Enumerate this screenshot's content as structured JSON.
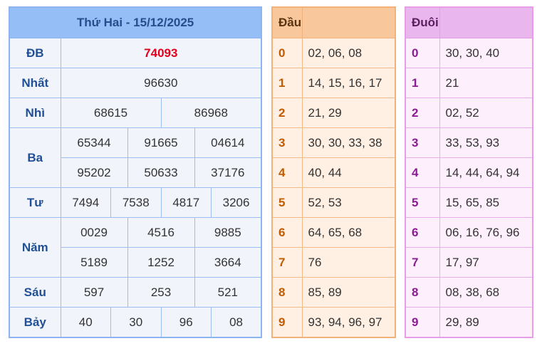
{
  "header": {
    "title": "Thứ Hai - 15/12/2025"
  },
  "prizes": {
    "db": {
      "label": "ĐB",
      "values": [
        "74093"
      ]
    },
    "nhat": {
      "label": "Nhất",
      "values": [
        "96630"
      ]
    },
    "nhi": {
      "label": "Nhì",
      "values": [
        "68615",
        "86968"
      ]
    },
    "ba": {
      "label": "Ba",
      "values": [
        "65344",
        "91665",
        "04614",
        "95202",
        "50633",
        "37176"
      ]
    },
    "tu": {
      "label": "Tư",
      "values": [
        "7494",
        "7538",
        "4817",
        "3206"
      ]
    },
    "nam": {
      "label": "Năm",
      "values": [
        "0029",
        "4516",
        "9885",
        "5189",
        "1252",
        "3664"
      ]
    },
    "sau": {
      "label": "Sáu",
      "values": [
        "597",
        "253",
        "521"
      ]
    },
    "bay": {
      "label": "Bảy",
      "values": [
        "40",
        "30",
        "96",
        "08"
      ]
    }
  },
  "dau": {
    "header": "Đầu",
    "rows": [
      {
        "digit": "0",
        "values": "02, 06, 08"
      },
      {
        "digit": "1",
        "values": "14, 15, 16, 17"
      },
      {
        "digit": "2",
        "values": "21, 29"
      },
      {
        "digit": "3",
        "values": "30, 30, 33, 38"
      },
      {
        "digit": "4",
        "values": "40, 44"
      },
      {
        "digit": "5",
        "values": "52, 53"
      },
      {
        "digit": "6",
        "values": "64, 65, 68"
      },
      {
        "digit": "7",
        "values": "76"
      },
      {
        "digit": "8",
        "values": "85, 89"
      },
      {
        "digit": "9",
        "values": "93, 94, 96, 97"
      }
    ]
  },
  "duoi": {
    "header": "Đuôi",
    "rows": [
      {
        "digit": "0",
        "values": "30, 30, 40"
      },
      {
        "digit": "1",
        "values": "21"
      },
      {
        "digit": "2",
        "values": "02, 52"
      },
      {
        "digit": "3",
        "values": "33, 53, 93"
      },
      {
        "digit": "4",
        "values": "14, 44, 64, 94"
      },
      {
        "digit": "5",
        "values": "15, 65, 85"
      },
      {
        "digit": "6",
        "values": "06, 16, 76, 96"
      },
      {
        "digit": "7",
        "values": "17, 97"
      },
      {
        "digit": "8",
        "values": "08, 38, 68"
      },
      {
        "digit": "9",
        "values": "29, 89"
      }
    ]
  },
  "colors": {
    "results_header": "#95bdf6",
    "special_prize": "#e2001a",
    "dau_header": "#f8c79c",
    "duoi_header": "#eab6ee"
  }
}
